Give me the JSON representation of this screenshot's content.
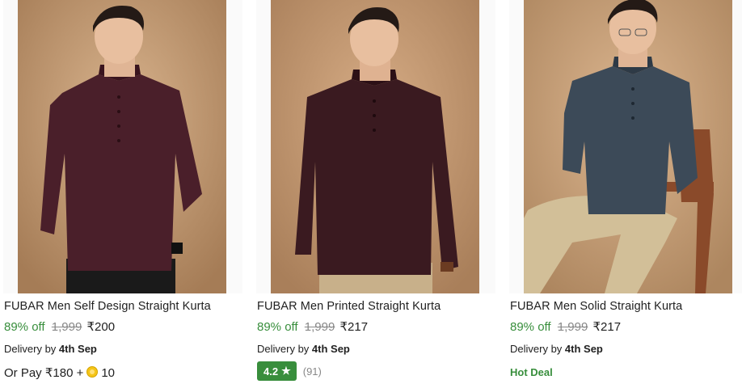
{
  "products": [
    {
      "title": "FUBAR Men Self Design Straight Kurta",
      "discount": "89% off",
      "mrp": "1,999",
      "price": "₹200",
      "delivery_prefix": "Delivery by",
      "delivery_date": "4th Sep",
      "pay_prefix": "Or Pay ₹180 +",
      "coins": "10",
      "colors": {
        "kurta": "#4a1f2a",
        "bg": "#c9a27c",
        "pants": "#1a1a1a"
      }
    },
    {
      "title": "FUBAR Men Printed Straight Kurta",
      "discount": "89% off",
      "mrp": "1,999",
      "price": "₹217",
      "delivery_prefix": "Delivery by",
      "delivery_date": "4th Sep",
      "rating": "4.2",
      "rating_count": "(91)",
      "colors": {
        "kurta": "#3a1a20",
        "bg": "#c79b74",
        "pants": "#c8b08a"
      }
    },
    {
      "title": "FUBAR Men Solid Straight Kurta",
      "discount": "89% off",
      "mrp": "1,999",
      "price": "₹217",
      "delivery_prefix": "Delivery by",
      "delivery_date": "4th Sep",
      "badge": "Hot Deal",
      "colors": {
        "kurta": "#3c4a58",
        "bg": "#cfa983",
        "pants": "#d2bf98"
      }
    }
  ],
  "accent": {
    "green": "#388e3c",
    "grey": "#878787"
  }
}
